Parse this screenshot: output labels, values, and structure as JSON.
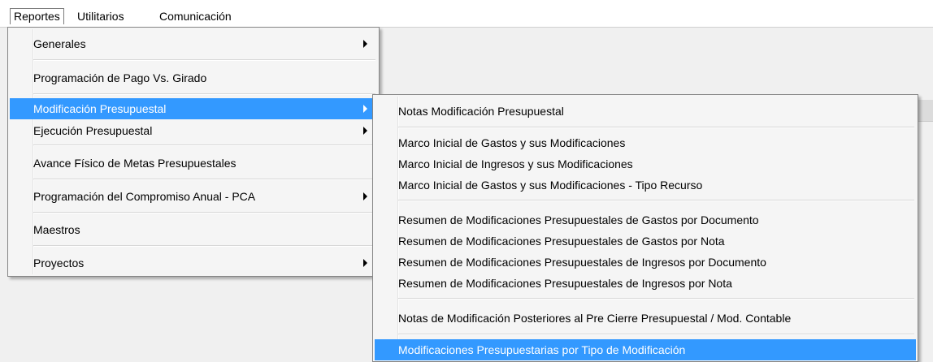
{
  "menubar": {
    "reportes": "Reportes",
    "utilitarios": "Utilitarios",
    "comunicacion": "Comunicación"
  },
  "reportes_menu": {
    "items": [
      {
        "label": "Generales",
        "submenu": true
      },
      {
        "label": "Programación de Pago Vs. Girado",
        "submenu": false
      },
      {
        "label": "Modificación Presupuestal",
        "submenu": true,
        "highlighted": true
      },
      {
        "label": "Ejecución Presupuestal",
        "submenu": true
      },
      {
        "label": "Avance Físico de Metas Presupuestales",
        "submenu": false
      },
      {
        "label": "Programación del Compromiso Anual - PCA",
        "submenu": true
      },
      {
        "label": "Maestros",
        "submenu": false
      },
      {
        "label": "Proyectos",
        "submenu": true
      }
    ]
  },
  "modificacion_submenu": {
    "items": [
      {
        "label": "Notas Modificación Presupuestal"
      },
      {
        "label": "Marco Inicial de Gastos y sus Modificaciones"
      },
      {
        "label": "Marco Inicial de Ingresos y sus Modificaciones"
      },
      {
        "label": "Marco Inicial de Gastos y sus Modificaciones - Tipo Recurso"
      },
      {
        "label": "Resumen de Modificaciones Presupuestales de Gastos por Documento"
      },
      {
        "label": "Resumen de Modificaciones Presupuestales de Gastos por Nota"
      },
      {
        "label": "Resumen de Modificaciones Presupuestales de Ingresos por Documento"
      },
      {
        "label": "Resumen de Modificaciones Presupuestales de Ingresos por Nota"
      },
      {
        "label": "Notas de Modificación Posteriores al Pre Cierre Presupuestal / Mod. Contable"
      },
      {
        "label": "Modificaciones Presupuestarias por Tipo de Modificación",
        "highlighted": true
      }
    ]
  },
  "colors": {
    "highlight": "#3399ff",
    "menu_background": "#f5f5f5",
    "workspace": "#f0f0f0"
  }
}
